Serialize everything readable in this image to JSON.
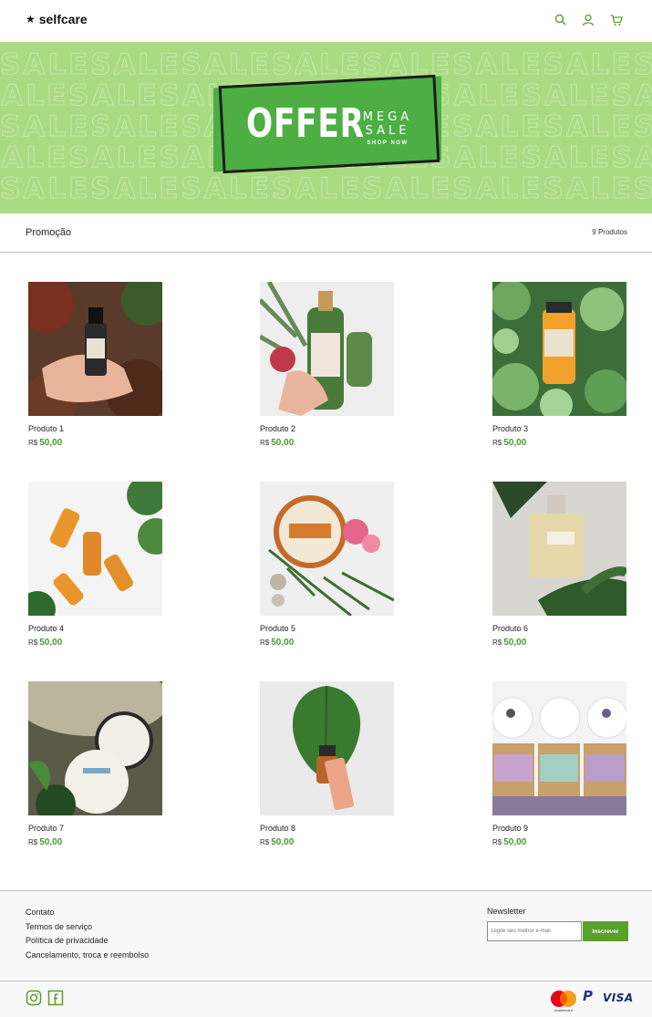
{
  "header": {
    "logo_text": "selfcare",
    "icons": [
      "search-icon",
      "user-icon",
      "cart-icon"
    ],
    "accent_color": "#5aa02c"
  },
  "banner": {
    "pattern_word": "SALE",
    "offer_text": "OFFER",
    "mega_text": "MEGA",
    "sale_text": "SALE",
    "shop_now_text": "SHOP NOW",
    "background_color": "#a9dc82",
    "badge_color": "#4cae43"
  },
  "category": {
    "title": "Promoção",
    "count": "9 Produtos"
  },
  "products": [
    {
      "name": "Produto 1",
      "currency": "R$",
      "price": "50,00"
    },
    {
      "name": "Produto 2",
      "currency": "R$",
      "price": "50,00"
    },
    {
      "name": "Produto 3",
      "currency": "R$",
      "price": "50,00"
    },
    {
      "name": "Produto 4",
      "currency": "R$",
      "price": "50,00"
    },
    {
      "name": "Produto 5",
      "currency": "R$",
      "price": "50,00"
    },
    {
      "name": "Produto 6",
      "currency": "R$",
      "price": "50,00"
    },
    {
      "name": "Produto 7",
      "currency": "R$",
      "price": "50,00"
    },
    {
      "name": "Produto 8",
      "currency": "R$",
      "price": "50,00"
    },
    {
      "name": "Produto 9",
      "currency": "R$",
      "price": "50,00"
    }
  ],
  "footer": {
    "links": [
      "Contato",
      "Termos de serviço",
      "Política de privacidade",
      "Cancelamento, troca e reembolso"
    ],
    "newsletter_title": "Newsletter",
    "newsletter_placeholder": "Digite seu melhor e-mail",
    "newsletter_button": "Inscrever",
    "social_icons": [
      "instagram-icon",
      "facebook-icon"
    ],
    "payment_methods": [
      "mastercard",
      "paypal",
      "VISA"
    ],
    "mastercard_label": "mastercard",
    "visa_label": "VISA"
  }
}
